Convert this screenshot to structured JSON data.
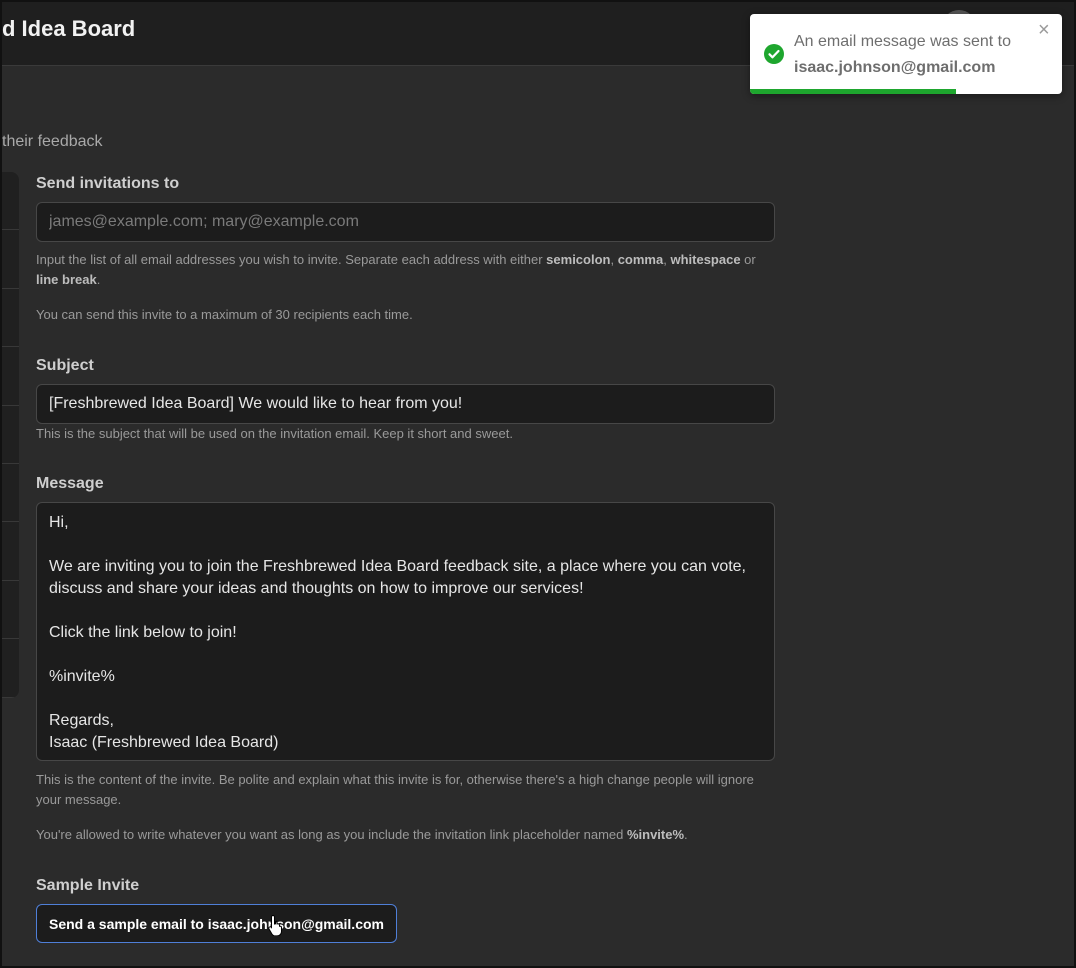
{
  "header": {
    "brand": "d Idea Board"
  },
  "page": {
    "subtitle": "their feedback"
  },
  "form": {
    "recipients": {
      "label": "Send invitations to",
      "placeholder": "james@example.com; mary@example.com",
      "value": "",
      "hint_prefix": "Input the list of all email addresses you wish to invite. Separate each address with either ",
      "hint_semicolon": "semicolon",
      "hint_sep1": ", ",
      "hint_comma": "comma",
      "hint_sep2": ", ",
      "hint_whitespace": "whitespace",
      "hint_or": " or ",
      "hint_linebreak": "line break",
      "hint_end": ".",
      "limit_hint": "You can send this invite to a maximum of 30 recipients each time."
    },
    "subject": {
      "label": "Subject",
      "value": "[Freshbrewed Idea Board] We would like to hear from you!",
      "hint": "This is the subject that will be used on the invitation email. Keep it short and sweet."
    },
    "message": {
      "label": "Message",
      "value": "Hi,\n\nWe are inviting you to join the Freshbrewed Idea Board feedback site, a place where you can vote, discuss and share your ideas and thoughts on how to improve our services!\n\nClick the link below to join!\n\n%invite%\n\nRegards,\nIsaac (Freshbrewed Idea Board)",
      "hint": "This is the content of the invite. Be polite and explain what this invite is for, otherwise there's a high change people will ignore your message.",
      "placeholder_hint_prefix": "You're allowed to write whatever you want as long as you include the invitation link placeholder named ",
      "placeholder_hint_token": "%invite%",
      "placeholder_hint_end": "."
    },
    "sample": {
      "label": "Sample Invite",
      "button_label": "Send a sample email to isaac.johnson@gmail.com"
    }
  },
  "toast": {
    "line1": "An email message was sent to",
    "line2": "isaac.johnson@gmail.com",
    "close_glyph": "×",
    "progress": 0.66,
    "color": "#1ea62e"
  },
  "icons": {
    "toast": "check-circle-icon",
    "close": "close-icon",
    "cursor": "hand-pointer-icon"
  }
}
